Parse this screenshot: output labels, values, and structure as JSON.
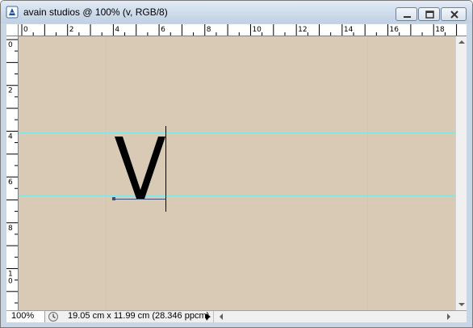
{
  "window": {
    "title": "avain studios @ 100% (v, RGB/8)",
    "icon": "photoshop-document-icon",
    "buttons": [
      "minimize-icon",
      "maximize-icon",
      "close-icon"
    ]
  },
  "rulers": {
    "unit": "cm",
    "top_labels": [
      "0",
      "2",
      "4",
      "6",
      "8",
      "10",
      "12",
      "14",
      "16",
      "18"
    ],
    "left_labels": [
      "0",
      "2",
      "4",
      "6",
      "8",
      "10"
    ]
  },
  "canvas": {
    "background": "#d8cab4",
    "guide_color": "#7fe6e6",
    "text_layer": "v"
  },
  "status_bar": {
    "zoom": "100%",
    "doc_size": "19.05 cm x 11.99 cm (28.346 ppcm)"
  }
}
